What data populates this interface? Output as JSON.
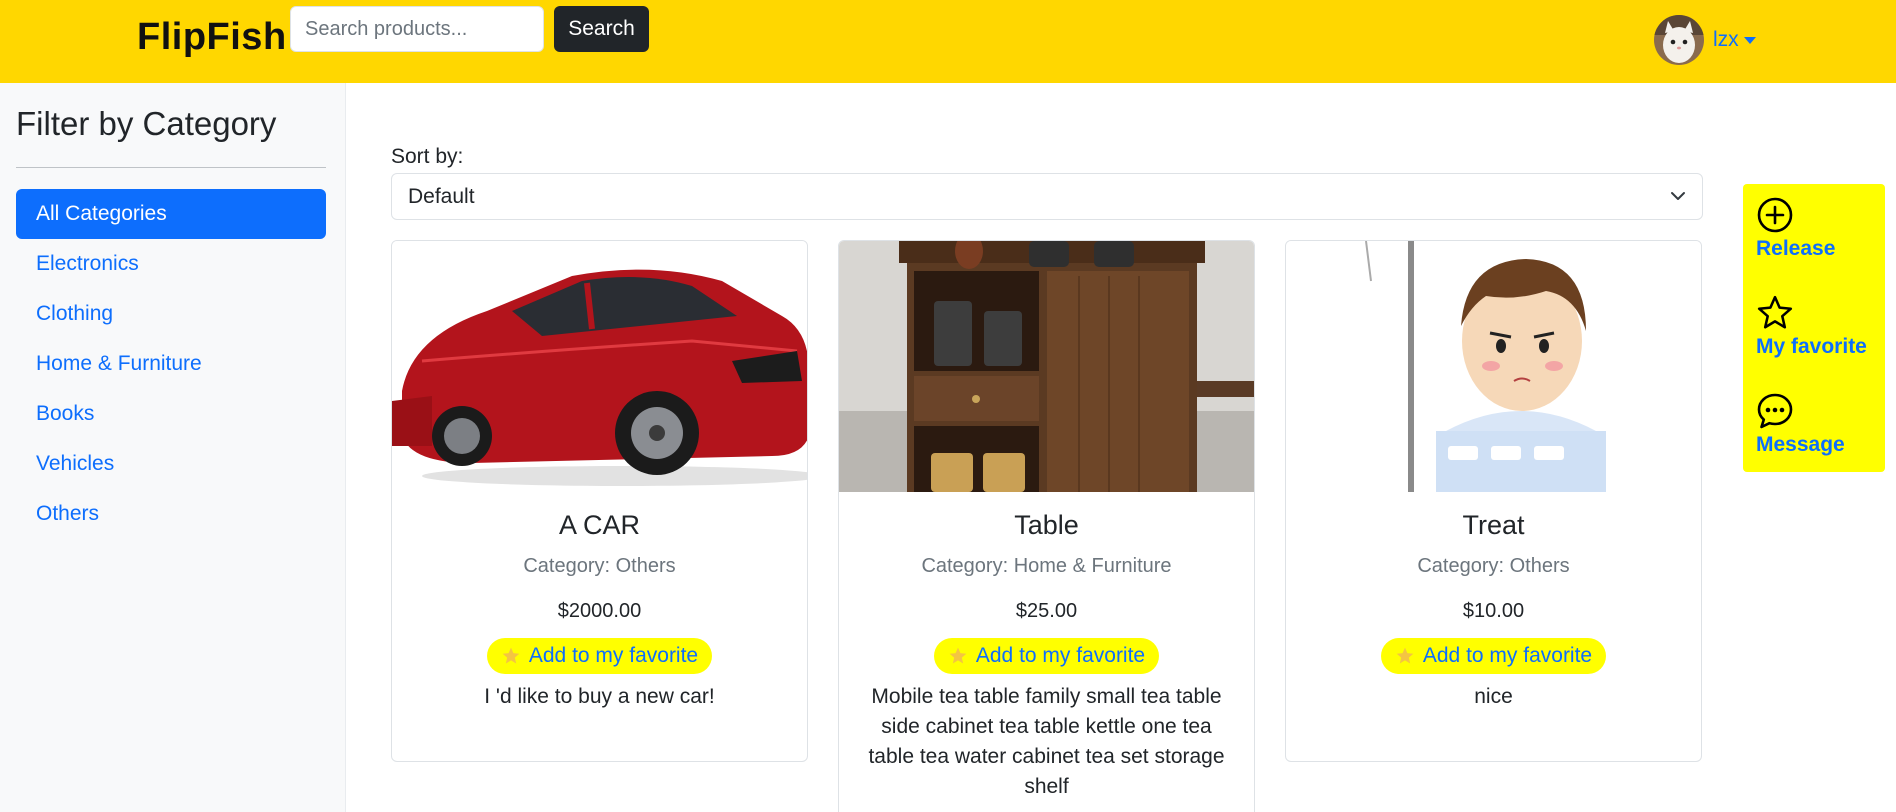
{
  "header": {
    "brand": "FlipFish",
    "search_placeholder": "Search products...",
    "search_button": "Search",
    "username": "lzx"
  },
  "sidebar": {
    "title": "Filter by Category",
    "categories": [
      {
        "label": "All Categories",
        "active": true
      },
      {
        "label": "Electronics"
      },
      {
        "label": "Clothing"
      },
      {
        "label": "Home & Furniture"
      },
      {
        "label": "Books"
      },
      {
        "label": "Vehicles"
      },
      {
        "label": "Others"
      }
    ]
  },
  "sort": {
    "label": "Sort by:",
    "selected": "Default"
  },
  "products": [
    {
      "title": "A CAR",
      "category": "Category: Others",
      "price": "$2000.00",
      "favorite_label": "Add to my favorite",
      "description": "I 'd like to buy a new car!",
      "image": "red-suv-photo"
    },
    {
      "title": "Table",
      "category": "Category: Home & Furniture",
      "price": "$25.00",
      "favorite_label": "Add to my favorite",
      "description": "Mobile tea table family small tea table side cabinet tea table kettle one tea table tea water cabinet tea set storage shelf",
      "image": "tea-cabinet-photo"
    },
    {
      "title": "Treat",
      "category": "Category: Others",
      "price": "$10.00",
      "favorite_label": "Add to my favorite",
      "description": "nice",
      "image": "cartoon-boy-in-hospital-bed"
    }
  ],
  "float_panel": {
    "items": [
      {
        "label": "Release",
        "icon": "plus-circle-icon"
      },
      {
        "label": "My favorite",
        "icon": "star-icon"
      },
      {
        "label": "Message",
        "icon": "chat-bubble-icon"
      }
    ]
  },
  "colors": {
    "header_bg": "#FFD700",
    "primary": "#0d6efd",
    "favorite_bg": "#FFFF00",
    "search_button_bg": "#212529"
  }
}
